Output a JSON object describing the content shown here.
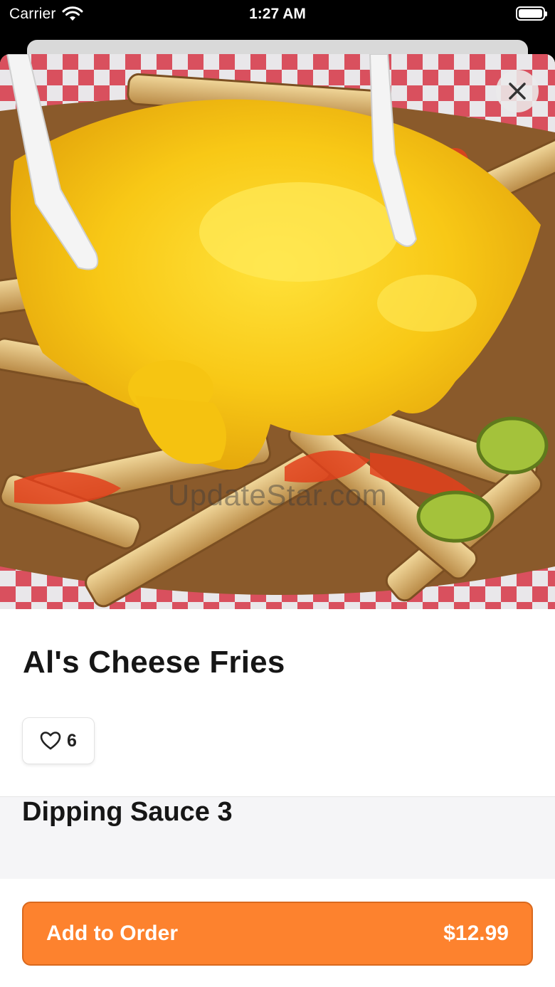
{
  "status_bar": {
    "carrier": "Carrier",
    "time": "1:27 AM"
  },
  "hero": {
    "image_subject": "cheese fries in paper-lined basket",
    "watermark": "UpdateStar.com"
  },
  "icons": {
    "close": "close-icon",
    "like": "heart-outline-icon",
    "wifi": "wifi-icon",
    "battery": "battery-icon"
  },
  "item": {
    "name": "Al's Cheese Fries",
    "likes": "6"
  },
  "options": {
    "section_title": "Dipping Sauce 3"
  },
  "footer": {
    "add_label": "Add to Order",
    "price": "$12.99",
    "accent_color": "#fd822e"
  }
}
